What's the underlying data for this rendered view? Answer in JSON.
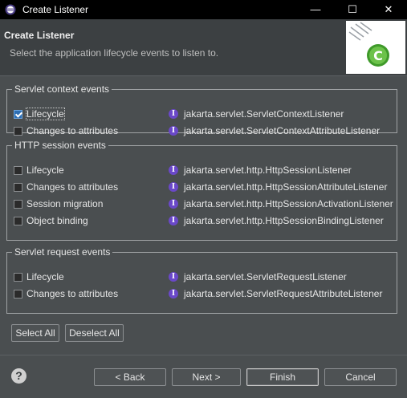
{
  "window": {
    "title": "Create Listener",
    "controls": {
      "minimize": "—",
      "maximize": "☐",
      "close": "✕"
    }
  },
  "header": {
    "title": "Create Listener",
    "description": "Select the application lifecycle events to listen to."
  },
  "groups": [
    {
      "legend": "Servlet context events",
      "rows": [
        {
          "label": "Lifecycle",
          "checked": true,
          "class": "jakarta.servlet.ServletContextListener"
        },
        {
          "label": "Changes to attributes",
          "checked": false,
          "class": "jakarta.servlet.ServletContextAttributeListener"
        }
      ]
    },
    {
      "legend": "HTTP session events",
      "rows": [
        {
          "label": "Lifecycle",
          "checked": false,
          "class": "jakarta.servlet.http.HttpSessionListener"
        },
        {
          "label": "Changes to attributes",
          "checked": false,
          "class": "jakarta.servlet.http.HttpSessionAttributeListener"
        },
        {
          "label": "Session migration",
          "checked": false,
          "class": "jakarta.servlet.http.HttpSessionActivationListener"
        },
        {
          "label": "Object binding",
          "checked": false,
          "class": "jakarta.servlet.http.HttpSessionBindingListener"
        }
      ]
    },
    {
      "legend": "Servlet request events",
      "rows": [
        {
          "label": "Lifecycle",
          "checked": false,
          "class": "jakarta.servlet.ServletRequestListener"
        },
        {
          "label": "Changes to attributes",
          "checked": false,
          "class": "jakarta.servlet.ServletRequestAttributeListener"
        }
      ]
    }
  ],
  "interface_icon_glyph": "I",
  "selection_buttons": {
    "select_all": "Select All",
    "deselect_all": "Deselect All"
  },
  "footer": {
    "help": "?",
    "back": "< Back",
    "next": "Next >",
    "finish": "Finish",
    "cancel": "Cancel"
  },
  "colors": {
    "background": "#4a4e50",
    "header_background": "#3c4042",
    "checkbox_checked": "#2d6fb5",
    "interface_icon": "#6a48c9"
  }
}
